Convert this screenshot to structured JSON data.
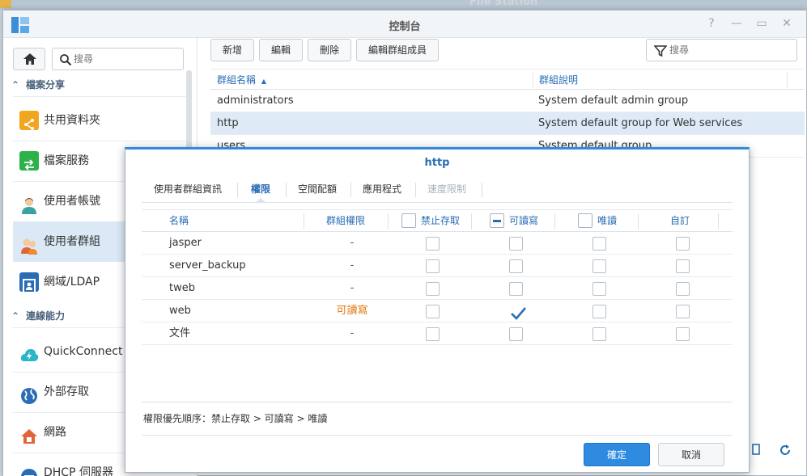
{
  "background_app": {
    "title": "File Station"
  },
  "window": {
    "title": "控制台",
    "controls": [
      "help-icon",
      "minimize-icon",
      "maximize-icon",
      "close-icon"
    ]
  },
  "sidebar": {
    "search_placeholder": "搜尋",
    "sections": [
      {
        "title": "檔案分享",
        "items": [
          {
            "label": "共用資料夾",
            "icon": "shared-folder-icon",
            "color": "#f2a61f"
          },
          {
            "label": "檔案服務",
            "icon": "file-services-icon",
            "color": "#2db24a"
          },
          {
            "label": "使用者帳號",
            "icon": "user-icon",
            "color": "#3a8fd6"
          },
          {
            "label": "使用者群組",
            "icon": "group-icon",
            "color": "#e0663a",
            "active": true
          },
          {
            "label": "網域/LDAP",
            "icon": "domain-ldap-icon",
            "color": "#2a6db5"
          }
        ]
      },
      {
        "title": "連線能力",
        "items": [
          {
            "label": "QuickConnect",
            "icon": "quickconnect-icon",
            "color": "#29b6c9"
          },
          {
            "label": "外部存取",
            "icon": "external-access-icon",
            "color": "#2a6db5"
          },
          {
            "label": "網路",
            "icon": "network-icon",
            "color": "#e0663a"
          },
          {
            "label": "DHCP 伺服器",
            "icon": "dhcp-server-icon",
            "color": "#2a6db5"
          }
        ]
      }
    ]
  },
  "toolbar": {
    "create": "新增",
    "edit": "編輯",
    "delete": "刪除",
    "edit_members": "編輯群組成員",
    "filter_placeholder": "搜尋"
  },
  "group_table": {
    "columns": [
      "群組名稱",
      "群組說明"
    ],
    "rows": [
      {
        "name": "administrators",
        "desc": "System default admin group"
      },
      {
        "name": "http",
        "desc": "System default group for Web services",
        "selected": true
      },
      {
        "name": "users",
        "desc": "System default group"
      }
    ]
  },
  "dialog": {
    "title": "http",
    "tabs": [
      {
        "label": "使用者群組資訊",
        "state": "normal"
      },
      {
        "label": "權限",
        "state": "active"
      },
      {
        "label": "空間配額",
        "state": "normal"
      },
      {
        "label": "應用程式",
        "state": "normal"
      },
      {
        "label": "速度限制",
        "state": "disabled"
      }
    ],
    "columns": {
      "name": "名稱",
      "group_perm": "群組權限",
      "no_access": "禁止存取",
      "read_write": "可讀寫",
      "read_only": "唯讀",
      "custom": "自訂"
    },
    "header_checks": {
      "no_access": "unchecked",
      "read_write": "partial",
      "read_only": "unchecked"
    },
    "rows": [
      {
        "name": "jasper",
        "group_perm": "-",
        "no_access": false,
        "read_write": false,
        "read_only": false,
        "custom": false
      },
      {
        "name": "server_backup",
        "group_perm": "-",
        "no_access": false,
        "read_write": false,
        "read_only": false,
        "custom": false
      },
      {
        "name": "tweb",
        "group_perm": "-",
        "no_access": false,
        "read_write": false,
        "read_only": false,
        "custom": false
      },
      {
        "name": "web",
        "group_perm": "可讀寫",
        "group_perm_color": "#e07a1a",
        "no_access": false,
        "read_write": true,
        "read_only": false,
        "custom": false
      },
      {
        "name": "文件",
        "group_perm": "-",
        "no_access": false,
        "read_write": false,
        "read_only": false,
        "custom": false
      }
    ],
    "priority_note": "權限優先順序：禁止存取 > 可讀寫 > 唯讀",
    "ok": "確定",
    "cancel": "取消"
  },
  "accent_color": "#2e8be0"
}
